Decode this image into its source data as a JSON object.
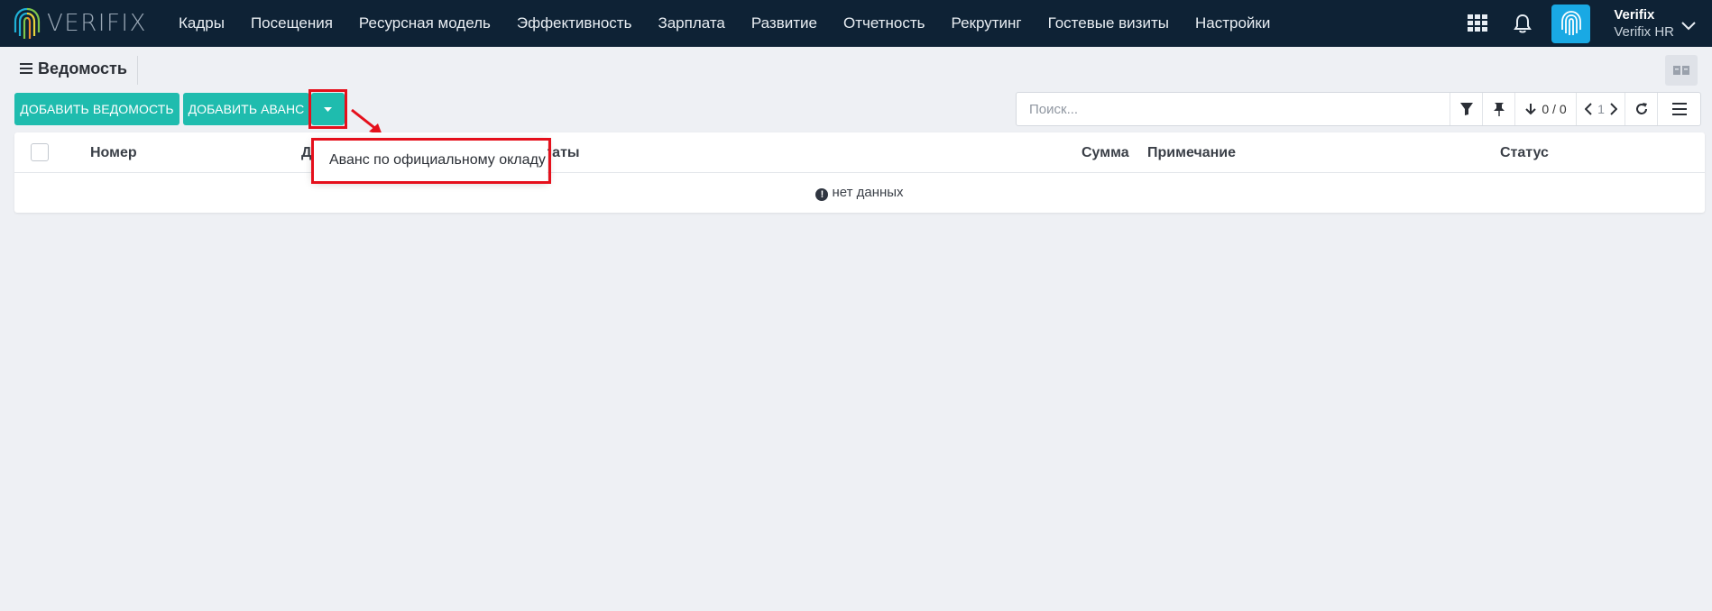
{
  "brand": {
    "logo_text": "VERIFIX"
  },
  "nav": [
    {
      "label": "Кадры"
    },
    {
      "label": "Посещения"
    },
    {
      "label": "Ресурсная модель"
    },
    {
      "label": "Эффективность"
    },
    {
      "label": "Зарплата"
    },
    {
      "label": "Развитие"
    },
    {
      "label": "Отчетность"
    },
    {
      "label": "Рекрутинг"
    },
    {
      "label": "Гостевые визиты"
    },
    {
      "label": "Настройки"
    }
  ],
  "user": {
    "name": "Verifix",
    "org": "Verifix HR"
  },
  "page": {
    "title": "Ведомость"
  },
  "actions": {
    "add_statement": "ДОБАВИТЬ ВЕДОМОСТЬ",
    "add_advance": "ДОБАВИТЬ АВАНС"
  },
  "search": {
    "placeholder": "Поиск..."
  },
  "toolbar": {
    "count": "0 / 0",
    "page": "1"
  },
  "table": {
    "columns": [
      {
        "label": "Номер"
      },
      {
        "label": "Д"
      },
      {
        "label": "латы"
      },
      {
        "label": "Сумма"
      },
      {
        "label": "Примечание"
      },
      {
        "label": "Статус"
      }
    ],
    "empty_text": "нет данных",
    "empty_icon": "!"
  },
  "dropdown": {
    "items": [
      {
        "label": "Аванс по официальному окладу"
      }
    ]
  },
  "colors": {
    "topbar": "#0e2235",
    "accent": "#1fbcae",
    "avatar": "#19a9e4",
    "highlight": "#e5101c"
  },
  "icons": [
    "hamburger-icon",
    "apps-grid-icon",
    "bell-icon",
    "fingerprint-icon",
    "chevron-down-icon",
    "filter-icon",
    "pin-icon",
    "sort-down-icon",
    "chevron-left-icon",
    "chevron-right-icon",
    "refresh-icon",
    "list-icon",
    "view-toggle-icon",
    "exclamation-icon",
    "caret-down-icon"
  ]
}
